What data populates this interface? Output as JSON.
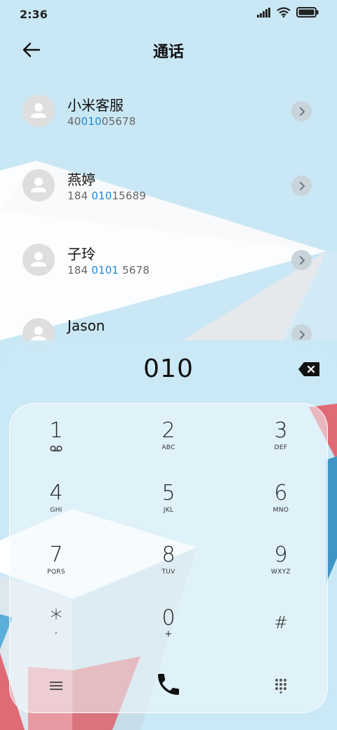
{
  "status_bar": {
    "time": "2:36",
    "icons": [
      "signal-icon",
      "wifi-icon",
      "battery-icon"
    ]
  },
  "header": {
    "title": "通话",
    "back_icon": "back-arrow-icon"
  },
  "contacts": [
    {
      "name": "小米客服",
      "number_pre": "40",
      "number_match": "010",
      "number_post": "05678"
    },
    {
      "name": "燕婷",
      "number_pre": "184 ",
      "number_match": "010",
      "number_post": "15689"
    },
    {
      "name": "子玲",
      "number_pre": "184 ",
      "number_match": "0101",
      "number_post": " 5678"
    },
    {
      "name": "Jason",
      "number_pre": "",
      "number_match": "",
      "number_post": ""
    }
  ],
  "dialer": {
    "input": "010",
    "keys": [
      {
        "digit": "1",
        "letters": "voicemail-icon"
      },
      {
        "digit": "2",
        "letters": "ABC"
      },
      {
        "digit": "3",
        "letters": "DEF"
      },
      {
        "digit": "4",
        "letters": "GHI"
      },
      {
        "digit": "5",
        "letters": "JKL"
      },
      {
        "digit": "6",
        "letters": "MNO"
      },
      {
        "digit": "7",
        "letters": "PQRS"
      },
      {
        "digit": "8",
        "letters": "TUV"
      },
      {
        "digit": "9",
        "letters": "WXYZ"
      },
      {
        "digit": "*",
        "letters": ","
      },
      {
        "digit": "0",
        "letters": "+"
      },
      {
        "digit": "#",
        "letters": ""
      }
    ],
    "bottom_icons": [
      "menu-icon",
      "phone-icon",
      "keypad-grid-icon"
    ]
  },
  "colors": {
    "background": "#c9e7f4",
    "highlight": "#1e88d6",
    "accent_red": "#e06a76",
    "accent_blue": "#3f96c6"
  }
}
